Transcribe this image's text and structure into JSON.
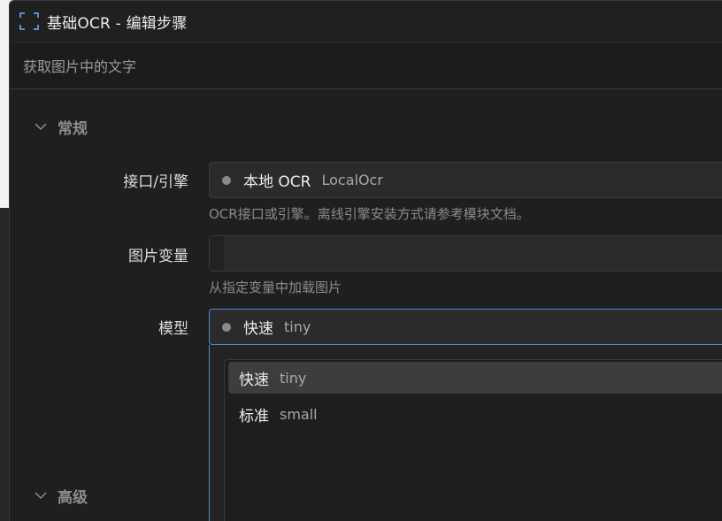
{
  "window": {
    "title": "基础OCR  -  编辑步骤",
    "subtitle": "获取图片中的文字"
  },
  "sections": {
    "general": {
      "title": "常规"
    },
    "advanced": {
      "title": "高级"
    }
  },
  "fields": {
    "engine": {
      "label": "接口/引擎",
      "value": "本地 OCR",
      "value_sub": "LocalOcr",
      "hint": "OCR接口或引擎。离线引擎安装方式请参考模块文档。"
    },
    "image_var": {
      "label": "图片变量",
      "value": "",
      "hint": "从指定变量中加载图片"
    },
    "model": {
      "label": "模型",
      "value": "快速",
      "value_sub": "tiny",
      "options": [
        {
          "label": "快速",
          "sub": "tiny",
          "selected": true
        },
        {
          "label": "标准",
          "sub": "small",
          "selected": false
        }
      ]
    }
  },
  "colors": {
    "accent": "#4a8ad4",
    "background": "#1f1f1f",
    "field": "#2b2b2b",
    "status_dot": "#8a8a8a"
  },
  "icons": {
    "title": "ocr-bracket-icon",
    "section_toggle": "chevron-down-icon",
    "status": "status-dot-icon"
  }
}
